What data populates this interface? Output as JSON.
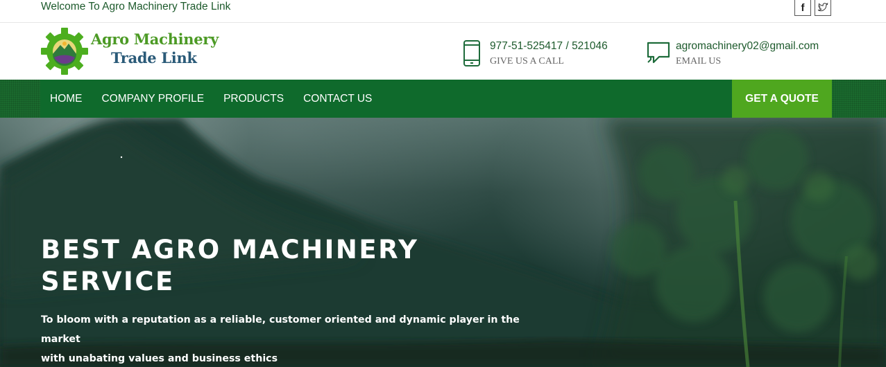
{
  "topbar": {
    "welcome": "Welcome To Agro Machinery Trade Link",
    "social": [
      {
        "icon": "facebook-icon",
        "glyph": "f"
      },
      {
        "icon": "twitter-icon"
      }
    ]
  },
  "header": {
    "logo": {
      "line1": "Agro Machinery",
      "line2": "Trade Link"
    },
    "phone": {
      "icon": "mobile-phone-icon",
      "value": "977-51-525417 / 521046",
      "label": "GIVE US A CALL"
    },
    "email": {
      "icon": "chat-bubble-icon",
      "value": "agromachinery02@gmail.com",
      "label": "EMAIL US"
    }
  },
  "nav": {
    "items": [
      {
        "label": "HOME"
      },
      {
        "label": "COMPANY PROFILE"
      },
      {
        "label": "PRODUCTS"
      },
      {
        "label": "CONTACT US"
      }
    ],
    "cta": "GET A QUOTE"
  },
  "hero": {
    "title_line1": "BEST AGRO MACHINERY",
    "title_line2": "SERVICE",
    "subtitle_line1": "To bloom with a reputation as a reliable, customer oriented and dynamic player in the market",
    "subtitle_line2": "with unabating values and business ethics"
  },
  "colors": {
    "brand_green": "#0f6a2c",
    "accent_green": "#4fa71f",
    "text_green": "#1d5a2c"
  }
}
